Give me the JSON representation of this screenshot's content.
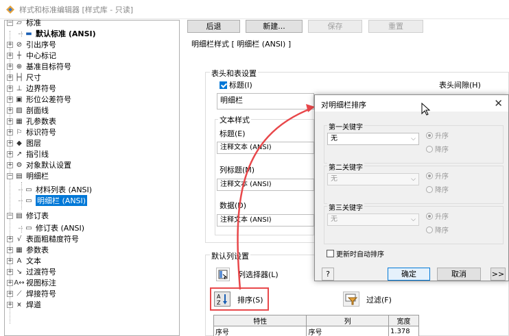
{
  "window": {
    "title": "样式和标准编辑器 [样式库 - 只读]"
  },
  "tree": {
    "items": [
      {
        "label": "标准",
        "icon": "standard-icon"
      },
      {
        "label": "默认标准 (ANSI)",
        "icon": "default-standard-icon"
      },
      {
        "label": "引出序号",
        "icon": "balloon-icon"
      },
      {
        "label": "中心标记",
        "icon": "center-mark-icon"
      },
      {
        "label": "基准目标符号",
        "icon": "datum-target-icon"
      },
      {
        "label": "尺寸",
        "icon": "dimension-icon"
      },
      {
        "label": "边界符号",
        "icon": "edge-symbol-icon"
      },
      {
        "label": "形位公差符号",
        "icon": "gdt-icon"
      },
      {
        "label": "剖面线",
        "icon": "hatch-icon"
      },
      {
        "label": "孔参数表",
        "icon": "hole-table-icon"
      },
      {
        "label": "标识符号",
        "icon": "id-symbol-icon"
      },
      {
        "label": "图层",
        "icon": "layer-icon"
      },
      {
        "label": "指引线",
        "icon": "leader-icon"
      },
      {
        "label": "对象默认设置",
        "icon": "object-defaults-icon"
      },
      {
        "label": "明细栏",
        "icon": "parts-list-icon"
      },
      {
        "label": "材料列表 (ANSI)",
        "icon": "style-item-icon"
      },
      {
        "label": "明细栏 (ANSI)",
        "icon": "style-item-icon"
      },
      {
        "label": "修订表",
        "icon": "revision-table-icon"
      },
      {
        "label": "修订表 (ANSI)",
        "icon": "style-item-icon"
      },
      {
        "label": "表面粗糙度符号",
        "icon": "surface-texture-icon"
      },
      {
        "label": "参数表",
        "icon": "table-icon"
      },
      {
        "label": "文本",
        "icon": "text-icon"
      },
      {
        "label": "过渡符号",
        "icon": "taper-icon"
      },
      {
        "label": "视图标注",
        "icon": "view-annotation-icon"
      },
      {
        "label": "焊接符号",
        "icon": "weld-symbol-icon"
      },
      {
        "label": "焊道",
        "icon": "weld-bead-icon"
      }
    ]
  },
  "toolbar": {
    "back": "后退",
    "new": "新建...",
    "save": "保存",
    "reset": "重置"
  },
  "main": {
    "style_header": "明细栏样式 [ 明细栏 (ANSI) ]",
    "header_group": "表头和表设置",
    "title_checkbox": "标题(I)",
    "title_checked": true,
    "title_value": "明细栏",
    "header_gap": "表头间隙(H)",
    "text_style_group": "文本样式",
    "title_label": "标题(E)",
    "title_style": "注释文本 (ANSI)",
    "column_header_label": "列标题(M)",
    "column_header_style": "注释文本 (ANSI)",
    "data_label": "数据(D)",
    "data_style": "注释文本 (ANSI)",
    "default_columns_group": "默认列设置",
    "column_chooser": "列选择器(L)",
    "sort_button": "排序(S)",
    "filter_button": "过滤(F)",
    "table": {
      "headers": [
        "特性",
        "列",
        "宽度"
      ],
      "rows": [
        [
          "序号",
          "序号",
          "1.378"
        ]
      ]
    }
  },
  "dialog": {
    "title": "对明细栏排序",
    "key1": "第一关键字",
    "key1_value": "无",
    "key2": "第二关键字",
    "key2_value": "无",
    "key3": "第三关键字",
    "key3_value": "无",
    "ascending": "升序",
    "descending": "降序",
    "auto_sort": "更新时自动排序",
    "ok": "确定",
    "cancel": "取消",
    "more": ">>",
    "help": "?"
  },
  "colors": {
    "selection": "#0078d7",
    "annotation": "#e8474a"
  }
}
